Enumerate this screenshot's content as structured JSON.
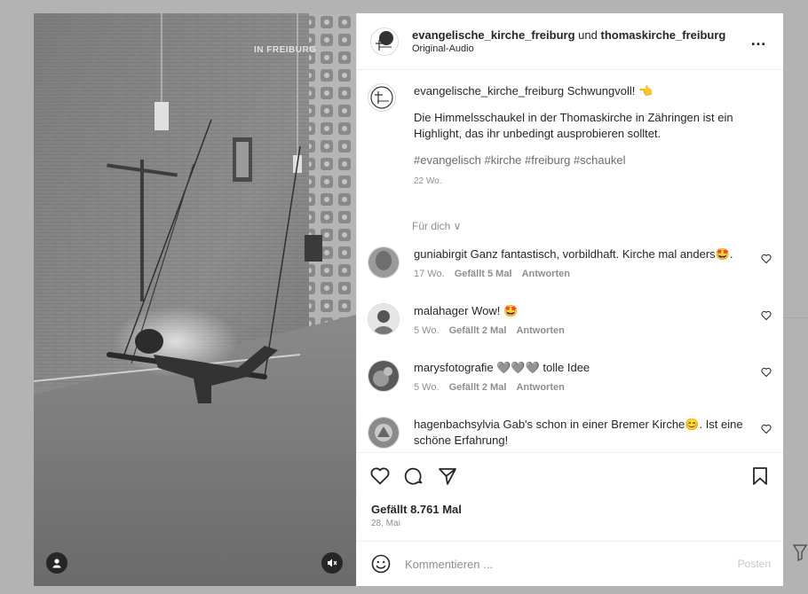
{
  "media": {
    "caption_text": "IN FREIBURG",
    "user_icon": "user-icon",
    "mute_icon": "audio-muted-icon"
  },
  "post": {
    "author": "evangelische_kirche_freiburg",
    "connector": "und",
    "collaborator": "thomaskirche_freiburg",
    "audio": "Original-Audio",
    "more_label": "…",
    "caption_user": "evangelische_kirche_freiburg",
    "caption_title": "Schwungvoll! 👈",
    "caption_desc": "Die Himmelsschaukel in der Thomaskirche in Zähringen ist ein Highlight, das ihr unbedingt ausprobieren solltet.",
    "caption_tags": "#evangelisch #kirche #freiburg #schaukel",
    "caption_time": "22 Wo.",
    "for_you": "Für dich ∨"
  },
  "comments": [
    {
      "user": "guniabirgit",
      "text": "Ganz fantastisch, vorbildhaft. Kirche mal anders🤩.",
      "time": "17 Wo.",
      "likes": "Gefällt 5 Mal",
      "reply": "Antworten"
    },
    {
      "user": "malahager",
      "text": "Wow! 🤩",
      "time": "5 Wo.",
      "likes": "Gefällt 2 Mal",
      "reply": "Antworten"
    },
    {
      "user": "marysfotografie",
      "text": "🩶🩶🩶 tolle Idee",
      "time": "5 Wo.",
      "likes": "Gefällt 2 Mal",
      "reply": "Antworten"
    },
    {
      "user": "hagenbachsylvia",
      "text": "Gab's schon in einer Bremer Kirche😊. Ist eine schöne Erfahrung!",
      "time": "",
      "likes": "",
      "reply": ""
    }
  ],
  "actions": {
    "likes_text": "Gefällt 8.761 Mal",
    "date": "28. Mai"
  },
  "composer": {
    "placeholder": "Kommentieren ...",
    "post_label": "Posten"
  },
  "colors": {
    "text": "#262626",
    "secondary": "#8e8e8e",
    "border": "#efefef"
  }
}
